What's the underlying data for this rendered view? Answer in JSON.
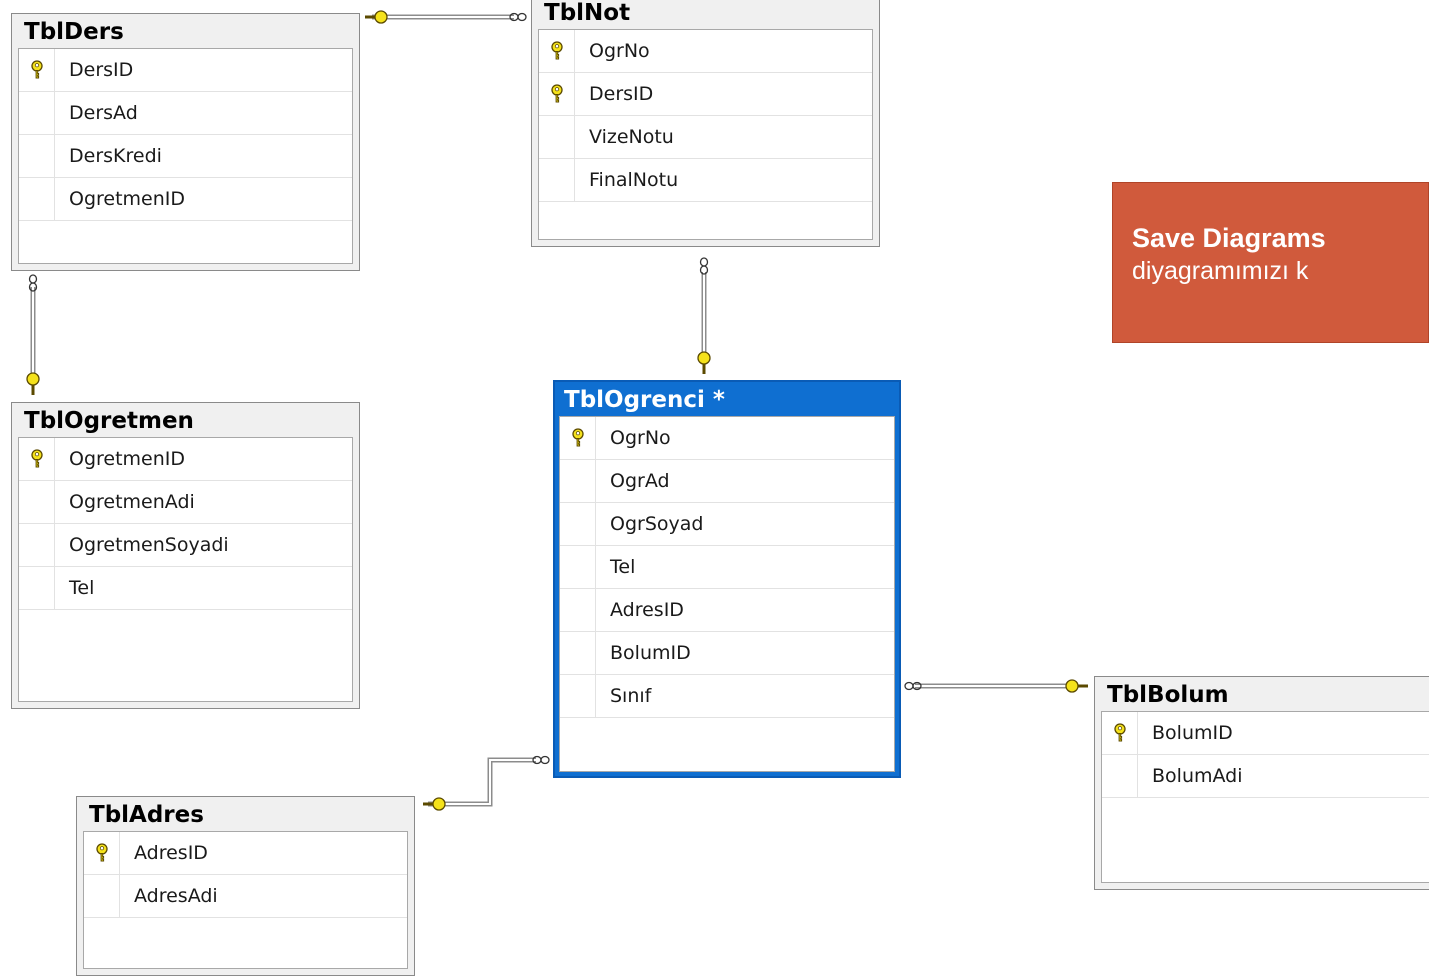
{
  "diagram": {
    "tables": [
      {
        "id": "ders",
        "name": "TblDers",
        "selected": false,
        "columns": [
          {
            "name": "DersID",
            "pk": true
          },
          {
            "name": "DersAd",
            "pk": false
          },
          {
            "name": "DersKredi",
            "pk": false
          },
          {
            "name": "OgretmenID",
            "pk": false
          }
        ]
      },
      {
        "id": "not",
        "name": "TblNot",
        "selected": false,
        "columns": [
          {
            "name": "OgrNo",
            "pk": true
          },
          {
            "name": "DersID",
            "pk": true
          },
          {
            "name": "VizeNotu",
            "pk": false
          },
          {
            "name": "FinalNotu",
            "pk": false
          }
        ]
      },
      {
        "id": "ogretmen",
        "name": "TblOgretmen",
        "selected": false,
        "columns": [
          {
            "name": "OgretmenID",
            "pk": true
          },
          {
            "name": "OgretmenAdi",
            "pk": false
          },
          {
            "name": "OgretmenSoyadi",
            "pk": false
          },
          {
            "name": "Tel",
            "pk": false
          }
        ]
      },
      {
        "id": "ogrenci",
        "name": "TblOgrenci *",
        "selected": true,
        "columns": [
          {
            "name": "OgrNo",
            "pk": true
          },
          {
            "name": "OgrAd",
            "pk": false
          },
          {
            "name": "OgrSoyad",
            "pk": false
          },
          {
            "name": "Tel",
            "pk": false
          },
          {
            "name": "AdresID",
            "pk": false
          },
          {
            "name": "BolumID",
            "pk": false
          },
          {
            "name": "Sınıf",
            "pk": false
          }
        ]
      },
      {
        "id": "adres",
        "name": "TblAdres",
        "selected": false,
        "columns": [
          {
            "name": "AdresID",
            "pk": true
          },
          {
            "name": "AdresAdi",
            "pk": false
          }
        ]
      },
      {
        "id": "bolum",
        "name": "TblBolum",
        "selected": false,
        "columns": [
          {
            "name": "BolumID",
            "pk": true
          },
          {
            "name": "BolumAdi",
            "pk": false
          }
        ]
      }
    ],
    "relationships": [
      {
        "from": "ders",
        "to": "not",
        "one_end": "ders",
        "many_end": "not"
      },
      {
        "from": "ders",
        "to": "ogretmen",
        "one_end": "ogretmen",
        "many_end": "ders"
      },
      {
        "from": "ogrenci",
        "to": "not",
        "one_end": "ogrenci",
        "many_end": "not"
      },
      {
        "from": "adres",
        "to": "ogrenci",
        "one_end": "adres",
        "many_end": "ogrenci"
      },
      {
        "from": "bolum",
        "to": "ogrenci",
        "one_end": "bolum",
        "many_end": "ogrenci"
      }
    ],
    "colors": {
      "selected_header": "#0f6fd1",
      "key_icon": "#f5e21b",
      "connector": "#8c8c8c"
    }
  },
  "callout": {
    "line1": "Save Diagrams",
    "line2": "diyagramımızı k"
  }
}
